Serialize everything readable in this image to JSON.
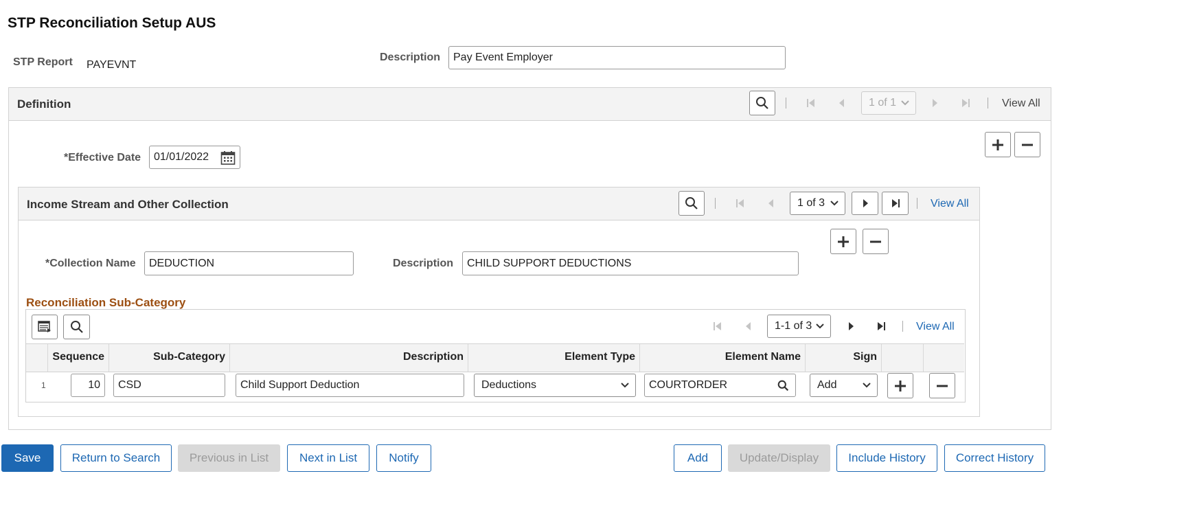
{
  "page_title": "STP Reconciliation Setup AUS",
  "header": {
    "stp_report_label": "STP Report",
    "stp_report_value": "PAYEVNT",
    "description_label": "Description",
    "description_value": "Pay Event Employer"
  },
  "definition": {
    "title": "Definition",
    "pager": "1 of 1",
    "view_all": "View All",
    "effective_date_label": "*Effective Date",
    "effective_date_value": "01/01/2022"
  },
  "collection": {
    "title": "Income Stream and Other Collection",
    "pager": "1 of 3",
    "view_all": "View All",
    "name_label": "*Collection Name",
    "name_value": "DEDUCTION",
    "description_label": "Description",
    "description_value": "CHILD SUPPORT DEDUCTIONS"
  },
  "subcategory": {
    "title": "Reconciliation Sub-Category",
    "pager": "1-1 of 3",
    "view_all": "View All",
    "columns": [
      "Sequence",
      "Sub-Category",
      "Description",
      "Element Type",
      "Element Name",
      "Sign"
    ],
    "rows": [
      {
        "row_number": "1",
        "sequence": "10",
        "sub_category": "CSD",
        "description": "Child Support Deduction",
        "element_type": "Deductions",
        "element_name": "COURTORDER",
        "sign": "Add"
      }
    ]
  },
  "footer": {
    "save": "Save",
    "return_to_search": "Return to Search",
    "previous_in_list": "Previous in List",
    "next_in_list": "Next in List",
    "notify": "Notify",
    "add": "Add",
    "update_display": "Update/Display",
    "include_history": "Include History",
    "correct_history": "Correct History"
  },
  "colors": {
    "accent": "#1d68b3",
    "section_title": "#9c4f12",
    "panel_header_bg": "#f3f3f3"
  }
}
